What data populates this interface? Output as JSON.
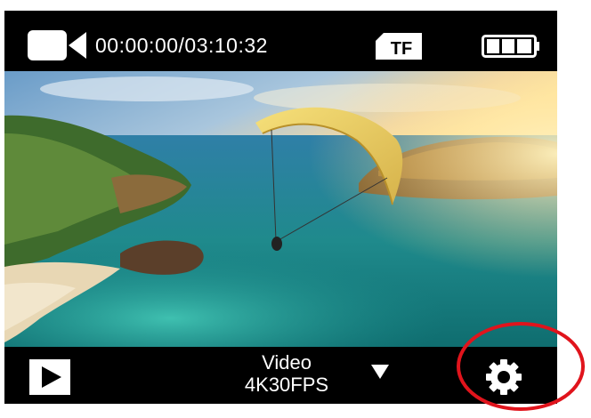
{
  "status_bar": {
    "record_mode_icon": "video-camera-icon",
    "timer": "00:00:00/03:10:32",
    "storage_badge": "TF",
    "battery_icon": "battery-full-icon"
  },
  "preview": {
    "content": "camera-live-preview"
  },
  "bottom_bar": {
    "playback_icon": "play-icon",
    "mode_label": "Video",
    "mode_setting": "4K30FPS",
    "mode_dropdown_icon": "triangle-down-icon",
    "settings_icon": "gear-icon"
  },
  "annotation": {
    "color": "#e0141c"
  },
  "colors": {
    "bar_background": "#000000",
    "text": "#ffffff"
  }
}
